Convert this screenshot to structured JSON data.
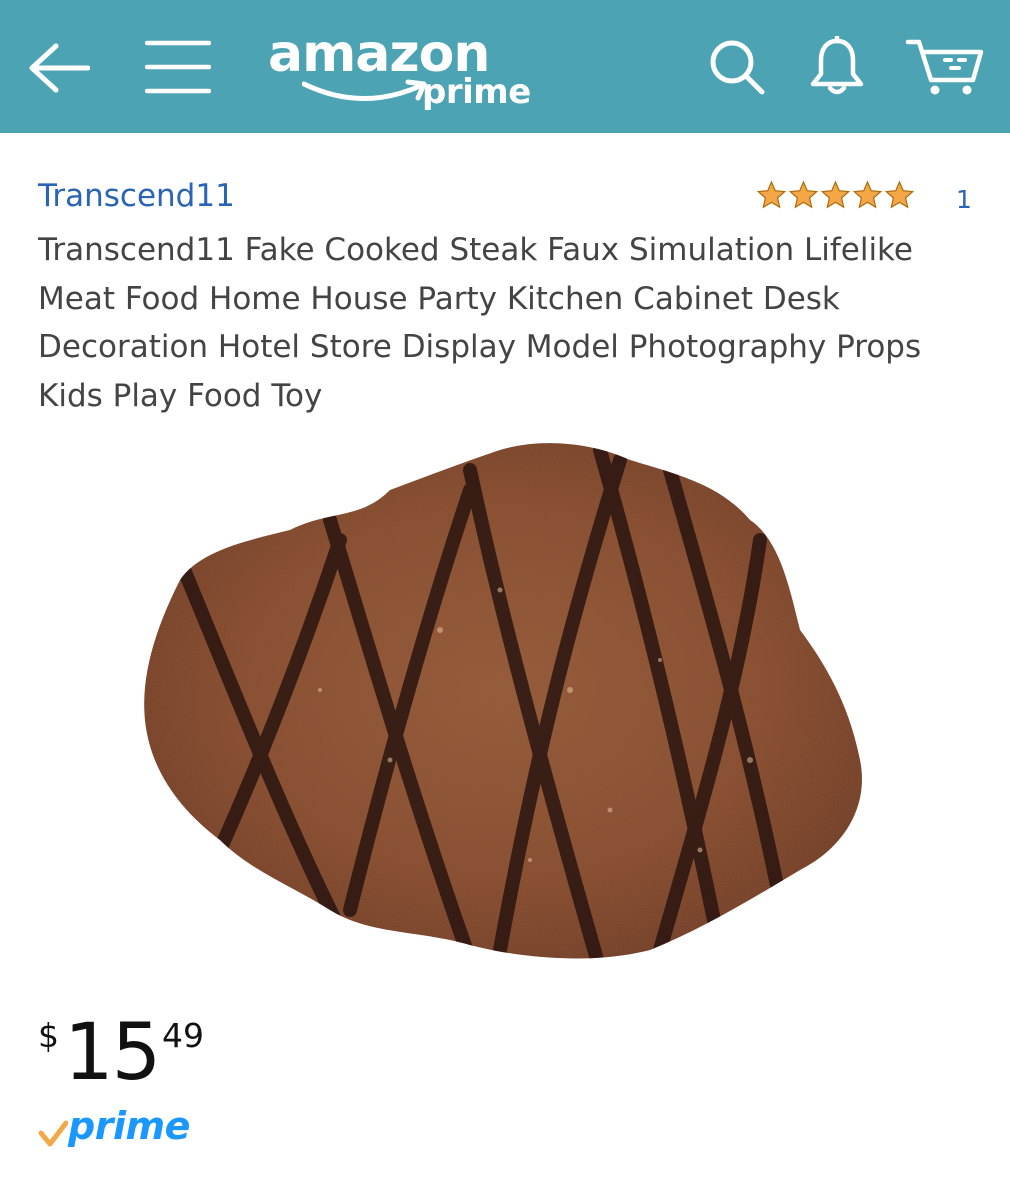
{
  "header": {
    "logo_main": "amazon",
    "logo_sub": "prime",
    "icons": [
      "back-arrow-icon",
      "hamburger-menu-icon",
      "search-icon",
      "bell-icon",
      "cart-icon"
    ],
    "background_color": "#4ca3b3"
  },
  "product": {
    "seller": "Transcend11",
    "rating_count": "1",
    "rating_stars": 5,
    "title": "Transcend11 Fake Cooked Steak Faux Simulation Lifelike Meat Food Home House Party Kitchen Cabinet Desk Decoration Hotel Store Display Model Photography Props Kids Play Food Toy",
    "price": {
      "currency": "$",
      "whole": "15",
      "fraction": "49"
    },
    "prime_badge": "prime"
  },
  "colors": {
    "link": "#2a64b6",
    "star": "#f3a847",
    "prime_blue": "#1a98ff",
    "prime_check": "#f3a847"
  }
}
